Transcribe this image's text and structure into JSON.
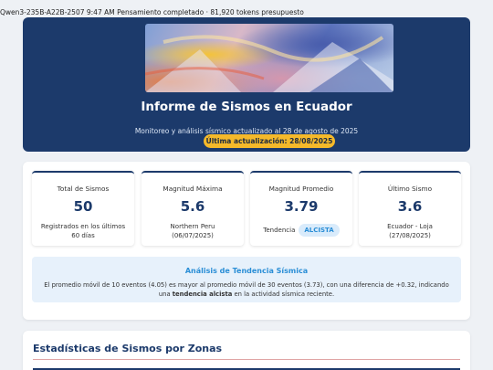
{
  "topbar": {
    "status_text": "Qwen3-235B-A22B-2507 9:47 AM Pensamiento completado · 81,920 tokens presupuesto"
  },
  "hero": {
    "title": "Informe de Sismos en Ecuador",
    "subtitle": "Monitoreo y análisis sísmico actualizado al 28 de agosto de 2025",
    "badge": "Última actualización: 28/08/2025",
    "banner_image": "abstract-painting-image"
  },
  "cards": [
    {
      "label": "Total de Sismos",
      "value": "50",
      "note": "Registrados en los últimos 60 días"
    },
    {
      "label": "Magnitud Máxima",
      "value": "5.6",
      "note_line1": "Northern Peru",
      "note_line2": "(06/07/2025)"
    },
    {
      "label": "Magnitud Promedio",
      "value": "3.79",
      "trend_label": "Tendencia",
      "trend_pill": "ALCISTA"
    },
    {
      "label": "Último Sismo",
      "value": "3.6",
      "note_line1": "Ecuador - Loja",
      "note_line2": "(27/08/2025)"
    }
  ],
  "analysis": {
    "title": "Análisis de Tendencia Sísmica",
    "text_before": "El promedio móvil de 10 eventos (4.05) es mayor al promedio móvil de 30 eventos (3.73), con una diferencia de +0.32, indicando una",
    "text_bold": "tendencia alcista",
    "text_after": "en la actividad sísmica reciente."
  },
  "zones": {
    "title": "Estadísticas de Sismos por Zonas"
  },
  "colors": {
    "primary": "#1c3a6b",
    "accent": "#f5b92a",
    "info": "#2a8ed6",
    "info_bg": "#e7f1fb",
    "page_bg": "#eef1f5"
  }
}
